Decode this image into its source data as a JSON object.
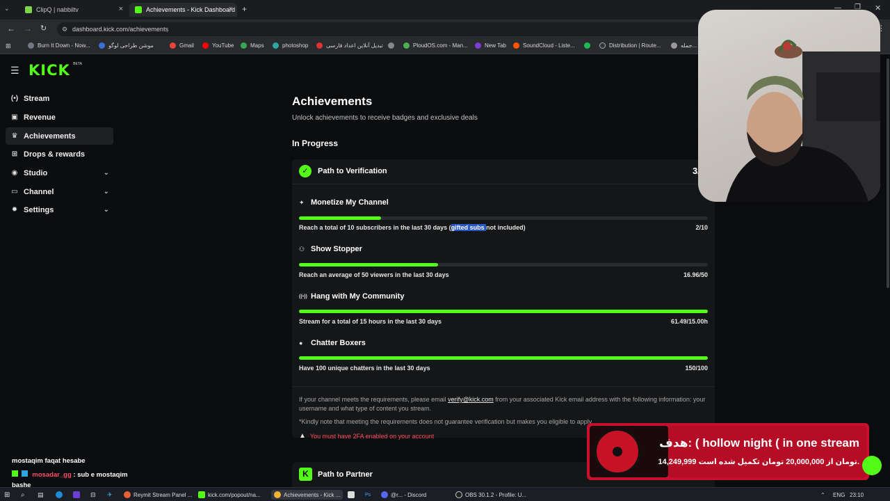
{
  "browser": {
    "tabs": [
      {
        "label": "ClipQ | nabbiltv",
        "active": false
      },
      {
        "label": "Achievements - Kick Dashboard",
        "active": true
      }
    ],
    "new_tab": "+",
    "url": "dashboard.kick.com/achievements",
    "bookmarks": [
      "Burn It Down - Now...",
      "موشن طراحی لوگو",
      "Gmail",
      "YouTube",
      "Maps",
      "photoshop",
      "تبدیل آنلاین اعداد فارسی",
      "",
      "PloudOS.com - Man...",
      "New Tab",
      "SoundCloud - Liste...",
      "",
      "Distribution | Route...",
      "جمله..."
    ]
  },
  "logo": {
    "text": "KICK",
    "badge": "BETA"
  },
  "sidebar": {
    "items": [
      {
        "label": "Stream",
        "icon": "broadcast-icon",
        "glyph": "(•)",
        "expandable": false,
        "active": false
      },
      {
        "label": "Revenue",
        "icon": "money-icon",
        "glyph": "▣",
        "expandable": false,
        "active": false
      },
      {
        "label": "Achievements",
        "icon": "trophy-icon",
        "glyph": "♛",
        "expandable": false,
        "active": true
      },
      {
        "label": "Drops & rewards",
        "icon": "gift-icon",
        "glyph": "⊞",
        "expandable": false,
        "active": false
      },
      {
        "label": "Studio",
        "icon": "camera-icon",
        "glyph": "◉",
        "expandable": true,
        "active": false
      },
      {
        "label": "Channel",
        "icon": "channel-icon",
        "glyph": "▭",
        "expandable": true,
        "active": false
      },
      {
        "label": "Settings",
        "icon": "gear-icon",
        "glyph": "✹",
        "expandable": true,
        "active": false
      }
    ]
  },
  "main": {
    "title": "Achievements",
    "subtitle": "Unlock achievements to receive badges and exclusive deals",
    "section": "In Progress",
    "verification": {
      "title": "Path to Verification",
      "count": "3/5",
      "achievements": [
        {
          "icon": "sparkle-icon",
          "glyph": "✦",
          "title": "Monetize My Channel",
          "desc_pre": "Reach a total of 10 subscribers in the last 30 days (",
          "desc_hl": "gifted subs ",
          "desc_post": "not included)",
          "value": "2/10",
          "progress": 0.2
        },
        {
          "icon": "people-icon",
          "glyph": "⚇",
          "title": "Show Stopper",
          "desc_pre": "Reach an average of 50 viewers in the last 30 days",
          "desc_hl": "",
          "desc_post": "",
          "value": "16.96/50",
          "progress": 0.34
        },
        {
          "icon": "signal-icon",
          "glyph": "((•))",
          "title": "Hang with My Community",
          "desc_pre": "Stream for a total of 15 hours in the last 30 days",
          "desc_hl": "",
          "desc_post": "",
          "value": "61.49/15.00h",
          "progress": 1.0
        },
        {
          "icon": "chat-icon",
          "glyph": "●",
          "title": "Chatter Boxers",
          "desc_pre": "Have 100 unique chatters in the last 30 days",
          "desc_hl": "",
          "desc_post": "",
          "value": "150/100",
          "progress": 1.0
        }
      ],
      "note_pre": "If your channel meets the requirements, please email ",
      "note_email": "verify@kick.com",
      "note_post": " from your associated Kick email address with the following information: your username and what type of content you stream.",
      "note2": "*Kindly note that meeting the requirements does not guarantee verification but makes you eligible to apply",
      "warning": "You must have 2FA enabled on your account"
    },
    "partner": {
      "title": "Path to Partner"
    }
  },
  "chat": [
    {
      "user": "",
      "text": "mostaqim faqat hesabe"
    },
    {
      "user": "mosadar_gg",
      "text": " : sub e mostaqim"
    },
    {
      "user": "",
      "text": "bashe"
    }
  ],
  "overlay": {
    "line1": "هدف: ( hollow night ( in one stream",
    "line2": "14,249,999 تومان از 20,000,000 تومان تکمیل شده است."
  },
  "taskbar": {
    "items": [
      "Reymit Stream Panel ...",
      "kick.com/popout/na...",
      "Achievements - Kick ...",
      "",
      "",
      "@r... - Discord",
      "OBS 30.1.2 - Profile: U..."
    ],
    "lang": "ENG",
    "time": "23:10"
  },
  "colors": {
    "accent": "#53fc18",
    "warning": "#ff4d5a",
    "highlight": "#2557c9"
  }
}
